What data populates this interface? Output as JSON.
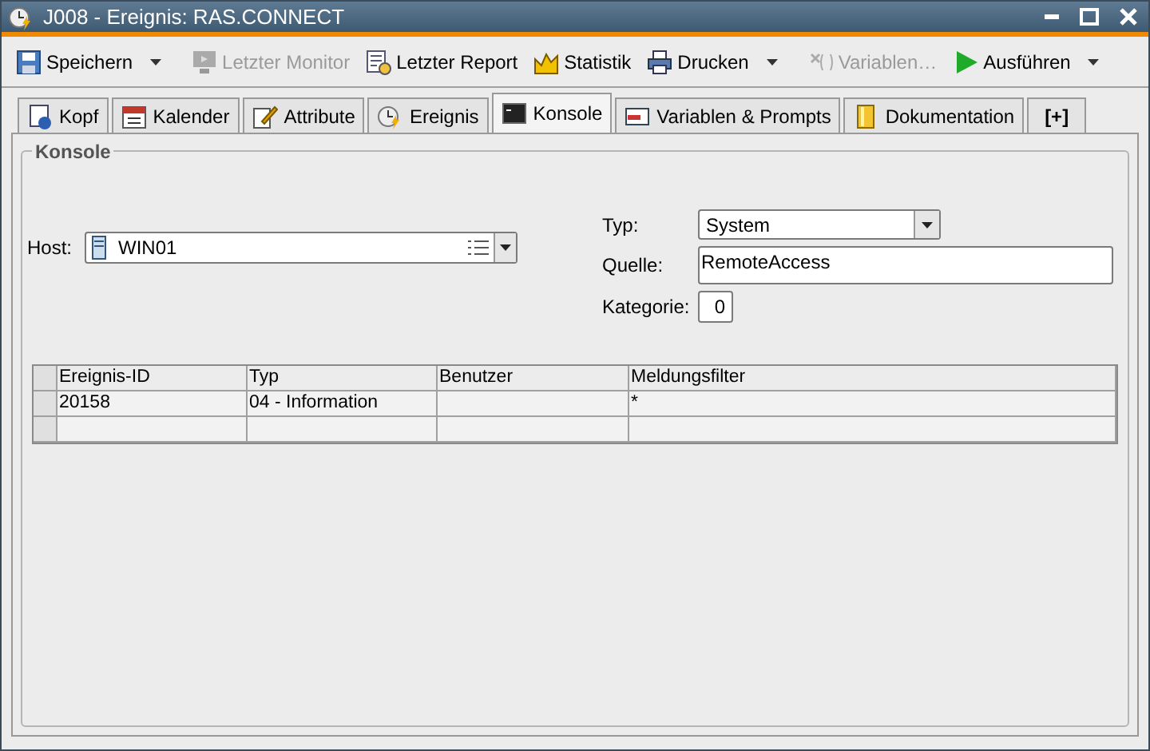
{
  "window": {
    "title": "J008 - Ereignis: RAS.CONNECT"
  },
  "toolbar": [
    {
      "label": "Speichern",
      "disabled": false,
      "dropdown": true
    },
    {
      "label": "Letzter Monitor",
      "disabled": true,
      "dropdown": false
    },
    {
      "label": "Letzter Report",
      "disabled": false,
      "dropdown": false
    },
    {
      "label": "Statistik",
      "disabled": false,
      "dropdown": false
    },
    {
      "label": "Drucken",
      "disabled": false,
      "dropdown": true
    },
    {
      "label": "Variablen…",
      "disabled": true,
      "dropdown": false
    },
    {
      "label": "Ausführen",
      "disabled": false,
      "dropdown": true
    }
  ],
  "tabs": [
    {
      "label": "Kopf",
      "selected": false
    },
    {
      "label": "Kalender",
      "selected": false
    },
    {
      "label": "Attribute",
      "selected": false
    },
    {
      "label": "Ereignis",
      "selected": false
    },
    {
      "label": "Konsole",
      "selected": true
    },
    {
      "label": "Variablen & Prompts",
      "selected": false
    },
    {
      "label": "Dokumentation",
      "selected": false
    },
    {
      "label": "[+]",
      "selected": false
    }
  ],
  "group": {
    "title": "Konsole"
  },
  "host": {
    "label": "Host:",
    "value": "WIN01"
  },
  "typ": {
    "label": "Typ:",
    "value": "System"
  },
  "quelle": {
    "label": "Quelle:",
    "value": "RemoteAccess"
  },
  "kategorie": {
    "label": "Kategorie:",
    "value": "0"
  },
  "table": {
    "columns": [
      "Ereignis-ID",
      "Typ",
      "Benutzer",
      "Meldungsfilter"
    ],
    "rows": [
      [
        "20158",
        "04 - Information",
        "",
        "*"
      ],
      [
        "",
        "",
        "",
        ""
      ]
    ]
  }
}
